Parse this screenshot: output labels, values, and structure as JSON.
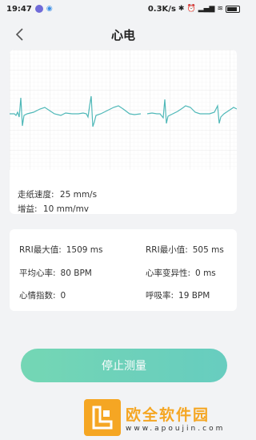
{
  "status_bar": {
    "time": "19:47",
    "network_speed": "0.3K/s",
    "icons": [
      "app-icon",
      "qq-icon",
      "bluetooth-icon",
      "alarm-icon",
      "wifi-icon",
      "signal-icon",
      "battery-icon"
    ]
  },
  "header": {
    "title": "心电",
    "back_icon": "chevron-left-icon"
  },
  "ecg": {
    "paper_speed_label": "走纸速度:",
    "paper_speed_value": "25 mm/s",
    "gain_label": "增益:",
    "gain_value": "10 mm/mv",
    "trace_color": "#4fb8b8",
    "grid_color": "#e6e6e6"
  },
  "stats": {
    "rri_max_label": "RRI最大值:",
    "rri_max_value": "1509 ms",
    "rri_min_label": "RRI最小值:",
    "rri_min_value": "505 ms",
    "avg_hr_label": "平均心率:",
    "avg_hr_value": "80 BPM",
    "hrv_label": "心率变异性:",
    "hrv_value": "0 ms",
    "mood_label": "心情指数:",
    "mood_value": "0",
    "resp_label": "呼吸率:",
    "resp_value": "19 BPM"
  },
  "stop_button": {
    "label": "停止测量",
    "color_start": "#5fd2aa",
    "color_end": "#4fc6b6"
  },
  "watermark": {
    "title": "欧全软件园",
    "url": "www.apoujin.com",
    "color": "#f5a623"
  }
}
